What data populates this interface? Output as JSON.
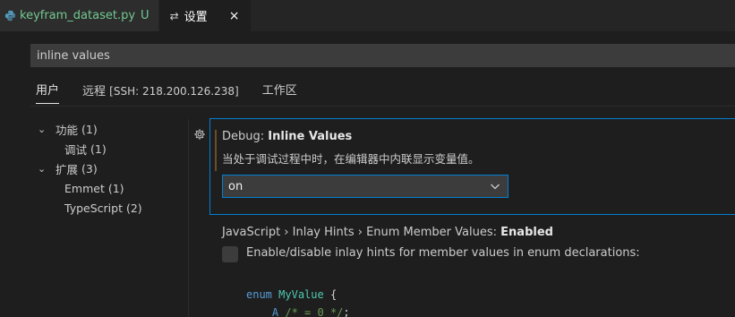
{
  "tabs": [
    {
      "label": "keyfram_dataset.py",
      "status": "U",
      "icon": "python-icon"
    },
    {
      "label": "设置",
      "icon": "settings-icon",
      "close": "×"
    }
  ],
  "search": {
    "value": "inline values"
  },
  "scopes": {
    "user": "用户",
    "remote": "远程",
    "remote_detail": "[SSH: 218.200.126.238]",
    "workspace": "工作区"
  },
  "toc": [
    {
      "label": "功能",
      "count": "(1)",
      "expanded": true
    },
    {
      "label": "调试",
      "count": "(1)"
    },
    {
      "label": "扩展",
      "count": "(3)",
      "expanded": true
    },
    {
      "label": "Emmet",
      "count": "(1)"
    },
    {
      "label": "TypeScript",
      "count": "(2)"
    }
  ],
  "setting1": {
    "category": "Debug: ",
    "name": "Inline Values",
    "description": "当处于调试过程中时，在编辑器中内联显示变量值。",
    "value": "on"
  },
  "setting2": {
    "category": "JavaScript › Inlay Hints › Enum Member Values: ",
    "name": "Enabled",
    "description": "Enable/disable inlay hints for member values in enum declarations:",
    "checked": false,
    "code_line1_kw": "enum",
    "code_line1_type": "MyValue",
    "code_line1_rest": " {",
    "code_line2_ident": "A",
    "code_line2_comment": " /* = 0 */",
    "code_line2_rest": ";"
  },
  "colors": {
    "accent": "#007fd4",
    "modified": "#6b4e23",
    "untracked": "#73c991"
  }
}
